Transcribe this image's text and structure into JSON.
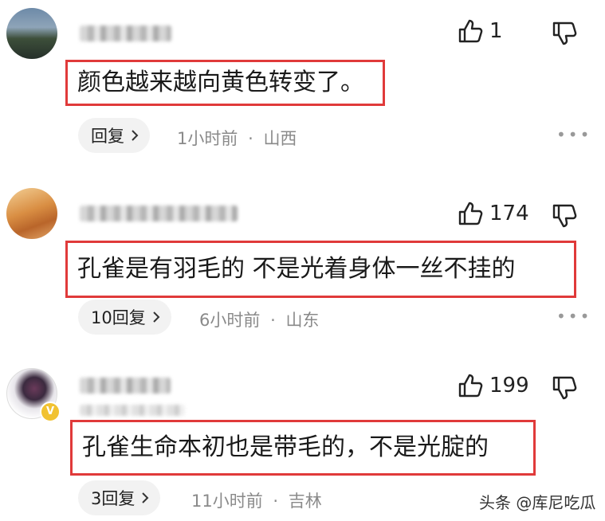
{
  "comments": [
    {
      "likes": "1",
      "text": "颜色越来越向黄色转变了。",
      "reply_label": "回复",
      "time": "1小时前",
      "location": "山西"
    },
    {
      "likes": "174",
      "text": "孔雀是有羽毛的 不是光着身体一丝不挂的",
      "reply_label": "10回复",
      "time": "6小时前",
      "location": "山东"
    },
    {
      "likes": "199",
      "text": "孔雀生命本初也是带毛的，不是光腚的",
      "reply_label": "3回复",
      "time": "11小时前",
      "location": "吉林"
    }
  ],
  "separator": "·",
  "watermark": "头条 @库尼吃瓜",
  "colors": {
    "highlight_border": "#e03a3a",
    "reply_bg": "#f2f2f2",
    "meta_text": "#8a8a8a"
  },
  "icons": [
    "thumbs-up-icon",
    "thumbs-down-icon",
    "chevron-right-icon",
    "more-icon",
    "verified-badge-icon"
  ]
}
